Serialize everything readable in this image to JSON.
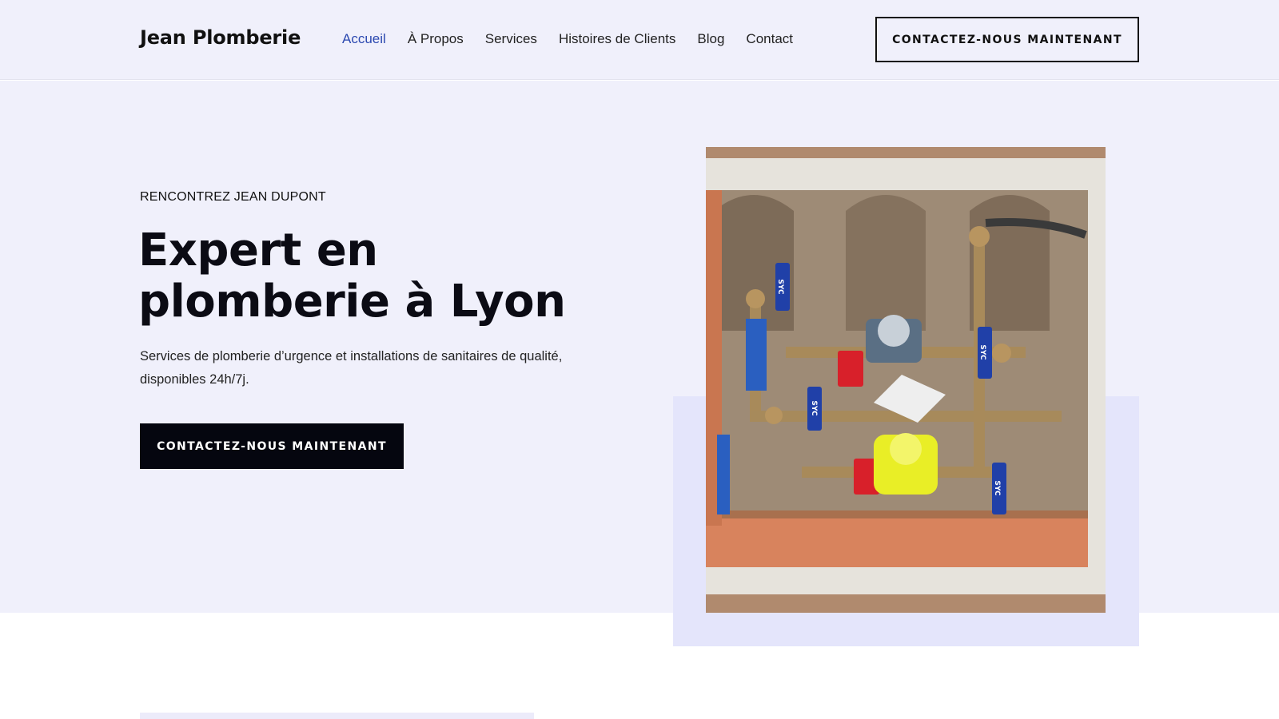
{
  "header": {
    "logo": "Jean Plomberie",
    "nav": [
      {
        "label": "Accueil",
        "active": true
      },
      {
        "label": "À Propos",
        "active": false
      },
      {
        "label": "Services",
        "active": false
      },
      {
        "label": "Histoires de Clients",
        "active": false
      },
      {
        "label": "Blog",
        "active": false
      },
      {
        "label": "Contact",
        "active": false
      }
    ],
    "cta_label": "CONTACTEZ-NOUS MAINTENANT"
  },
  "hero": {
    "eyebrow": "RENCONTREZ JEAN DUPONT",
    "headline": "Expert en plomberie à Lyon",
    "description": "Services de plomberie d’urgence et installations de sanitaires de qualité, disponibles 24h/7j.",
    "cta_label": "CONTACTEZ-NOUS MAINTENANT",
    "image_labels": [
      "SYC",
      "SYC",
      "SYC",
      "SYC"
    ]
  },
  "colors": {
    "hero_bg": "#f0f0fb",
    "accent_link": "#2c49b0",
    "button_dark": "#05060f",
    "accent_box": "#e4e5fb"
  }
}
